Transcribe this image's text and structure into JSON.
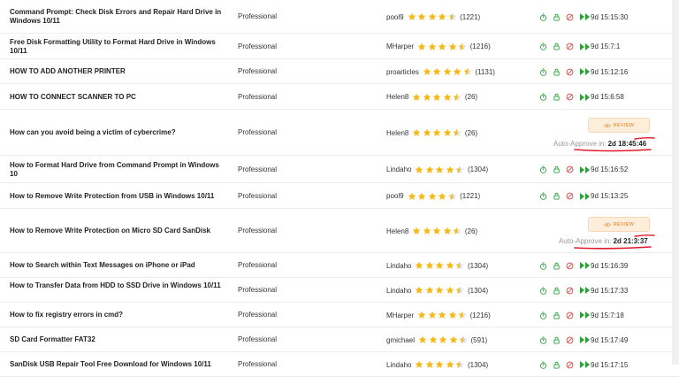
{
  "colors": {
    "star": "#f6b91a",
    "accent_green": "#2e9e3b",
    "block_red": "#e0443a",
    "review_bg": "#fdeedb",
    "review_text": "#e0a05c",
    "annotation_red": "#e3182d"
  },
  "rows": [
    {
      "title": "Command Prompt: Check Disk Errors and Repair Hard Drive in Windows 10/11",
      "type": "Professional",
      "writer": "pool9",
      "rating": 4.5,
      "reviews": "(1221)",
      "time": "9d 15:15:30"
    },
    {
      "title": "Free Disk Formatting Utility to Format Hard Drive in Windows 10/11",
      "type": "Professional",
      "writer": "MHarper",
      "rating": 4.5,
      "reviews": "(1216)",
      "time": "9d 15:7:1"
    },
    {
      "title": "HOW TO ADD ANOTHER PRINTER",
      "type": "Professional",
      "writer": "proarticles",
      "rating": 4.5,
      "reviews": "(1131)",
      "time": "9d 15:12:16"
    },
    {
      "title": "HOW TO CONNECT SCANNER TO PC",
      "type": "Professional",
      "writer": "Helen8",
      "rating": 4.5,
      "reviews": "(26)",
      "time": "9d 15:6:58"
    },
    {
      "title": "How can you avoid being a victim of cybercrime?",
      "type": "Professional",
      "writer": "Helen8",
      "rating": 4.5,
      "reviews": "(26)",
      "review_label": "REVIEW",
      "auto_label": "Auto-Approve in:",
      "countdown": "2d 18:45:46"
    },
    {
      "title": "How to Format Hard Drive from Command Prompt in Windows 10",
      "type": "Professional",
      "writer": "Lindaho",
      "rating": 4.5,
      "reviews": "(1304)",
      "time": "9d 15:16:52"
    },
    {
      "title": "How to Remove Write Protection from USB in Windows 10/11",
      "type": "Professional",
      "writer": "pool9",
      "rating": 4.5,
      "reviews": "(1221)",
      "time": "9d 15:13:25"
    },
    {
      "title": "How to Remove Write Protection on Micro SD Card SanDisk",
      "type": "Professional",
      "writer": "Helen8",
      "rating": 4.5,
      "reviews": "(26)",
      "review_label": "REVIEW",
      "auto_label": "Auto-Approve in:",
      "countdown": "2d 21:3:37"
    },
    {
      "title": "How to Search within Text Messages on iPhone or iPad",
      "type": "Professional",
      "writer": "Lindaho",
      "rating": 4.5,
      "reviews": "(1304)",
      "time": "9d 15:16:39"
    },
    {
      "title": "How to Transfer Data from HDD to SSD Drive in Windows 10/11",
      "type": "Professional",
      "writer": "Lindaho",
      "rating": 4.5,
      "reviews": "(1304)",
      "time": "9d 15:17:33"
    },
    {
      "title": "How to fix registry errors in cmd?",
      "type": "Professional",
      "writer": "MHarper",
      "rating": 4.5,
      "reviews": "(1216)",
      "time": "9d 15:7:18"
    },
    {
      "title": "SD Card Formatter FAT32",
      "type": "Professional",
      "writer": "gmichael",
      "rating": 4.5,
      "reviews": "(591)",
      "time": "9d 15:17:49"
    },
    {
      "title": "SanDisk USB Repair Tool Free Download for Windows 10/11",
      "type": "Professional",
      "writer": "Lindaho",
      "rating": 4.5,
      "reviews": "(1304)",
      "time": "9d 15:17:15"
    }
  ]
}
